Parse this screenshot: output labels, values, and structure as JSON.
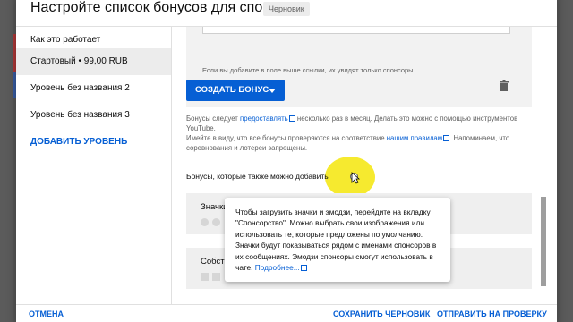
{
  "dialog": {
    "title": "Настройте список бонусов для спонсоров",
    "status_badge": "Черновик"
  },
  "sidebar": {
    "items": [
      {
        "label": "Как это работает"
      },
      {
        "label": "Стартовый • 99,00 RUB",
        "active": true
      },
      {
        "label": "Уровень без названия 2"
      },
      {
        "label": "Уровень без названия 3"
      }
    ],
    "add_level_label": "ДОБАВИТЬ УРОВЕНЬ"
  },
  "main": {
    "link_hint": "Если вы добавите в поле выше ссылки, их увидят только спонсоры.",
    "create_perk_button": "СОЗДАТЬ БОНУС",
    "info": {
      "line1_a": "Бонусы следует ",
      "line1_link": "предоставлять",
      "line1_b": " несколько раз в месяц. Делать это можно с помощью инструментов YouTube.",
      "line2_a": "Имейте в виду, что все бонусы проверяются на соответствие ",
      "line2_link": "нашим правилам",
      "line2_b": ". Напоминаем, что соревнования и лотереи запрещены."
    },
    "perks_section_label": "Бонусы, которые также можно добавить",
    "perk_cards": [
      {
        "title": "Значки"
      },
      {
        "title": "Собственные эмодзи"
      }
    ]
  },
  "tooltip": {
    "text": "Чтобы загрузить значки и эмодзи, перейдите на вкладку \"Спонсорство\". Можно выбрать свои изображения или использовать те, которые предложены по умолчанию. Значки будут показываться рядом с именами спонсоров в их сообщениях. Эмодзи спонсоры смогут использовать в чате. ",
    "link": "Подробнее..."
  },
  "footer": {
    "cancel": "ОТМЕНА",
    "save_draft": "СОХРАНИТЬ ЧЕРНОВИК",
    "submit": "ОТПРАВИТЬ НА ПРОВЕРКУ"
  },
  "colors": {
    "accent": "#065fd4",
    "highlight": "#f5e60a"
  },
  "icons": [
    "close-icon",
    "trash-icon",
    "external-link-icon",
    "help-icon",
    "dropdown-caret-icon",
    "mouse-pointer-icon"
  ]
}
